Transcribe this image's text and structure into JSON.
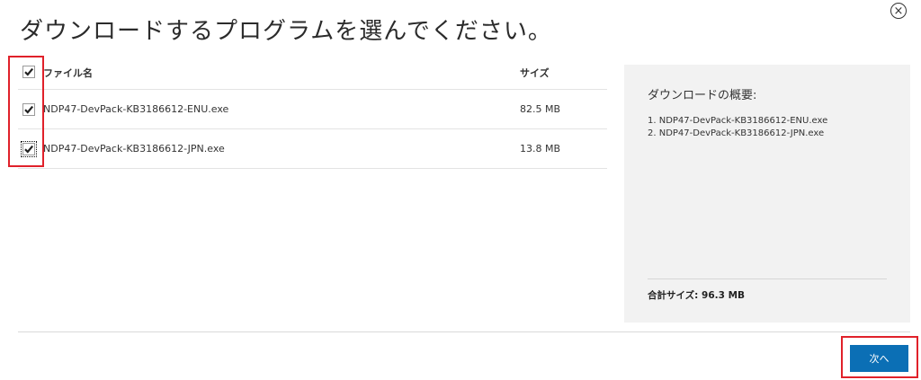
{
  "dialog": {
    "title": "ダウンロードするプログラムを選んでください。",
    "close_glyph": "×"
  },
  "table": {
    "headers": {
      "name": "ファイル名",
      "size": "サイズ"
    },
    "header_checked": true,
    "rows": [
      {
        "name": "NDP47-DevPack-KB3186612-ENU.exe",
        "size": "82.5 MB",
        "checked": true
      },
      {
        "name": "NDP47-DevPack-KB3186612-JPN.exe",
        "size": "13.8 MB",
        "checked": true
      }
    ]
  },
  "summary": {
    "heading": "ダウンロードの概要:",
    "items": [
      "1. NDP47-DevPack-KB3186612-ENU.exe",
      "2. NDP47-DevPack-KB3186612-JPN.exe"
    ],
    "total": "合計サイズ: 96.3 MB"
  },
  "footer": {
    "next_label": "次へ"
  },
  "colors": {
    "accent": "#0b6fb5",
    "highlight": "#e0212a",
    "panel_bg": "#f2f2f2"
  },
  "icons": [
    "close-circle-icon",
    "checkmark-icon"
  ]
}
